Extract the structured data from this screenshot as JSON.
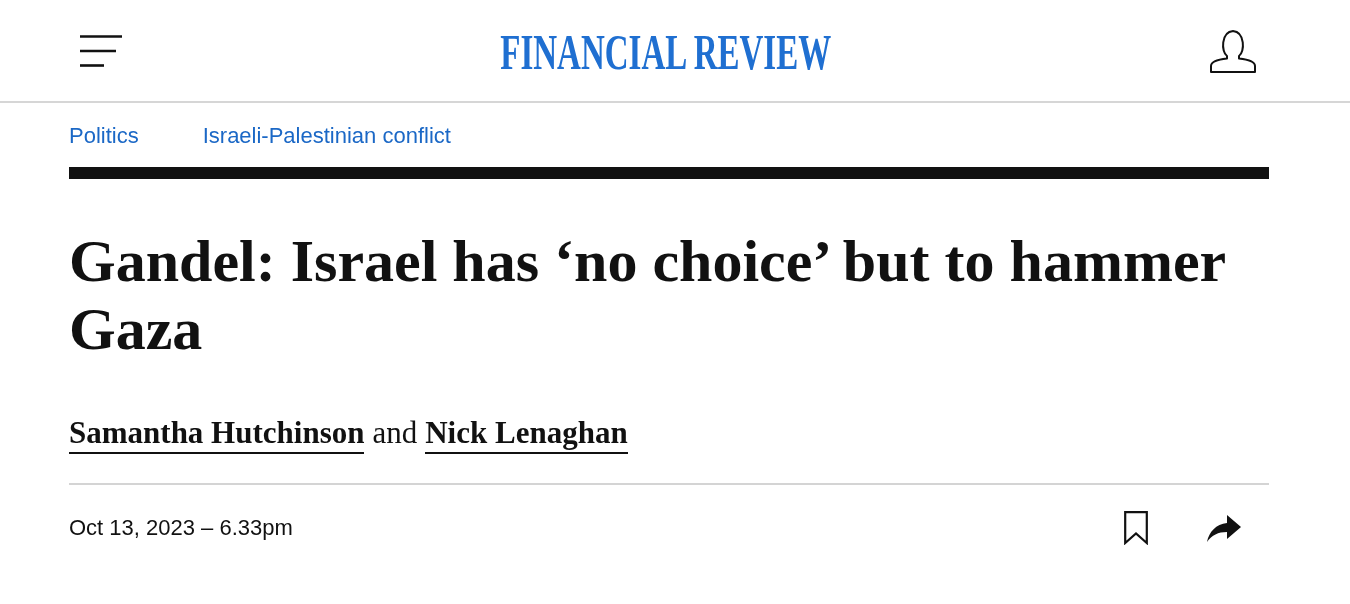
{
  "header": {
    "logo": "FINANCIAL REVIEW"
  },
  "breadcrumbs": [
    {
      "label": "Politics"
    },
    {
      "label": "Israeli-Palestinian conflict"
    }
  ],
  "headline": "Gandel: Israel has ‘no choice’ but to hammer Gaza",
  "byline": {
    "authors": [
      "Samantha Hutchinson",
      "Nick Lenaghan"
    ],
    "conjunction": "and"
  },
  "timestamp": "Oct 13, 2023 – 6.33pm"
}
